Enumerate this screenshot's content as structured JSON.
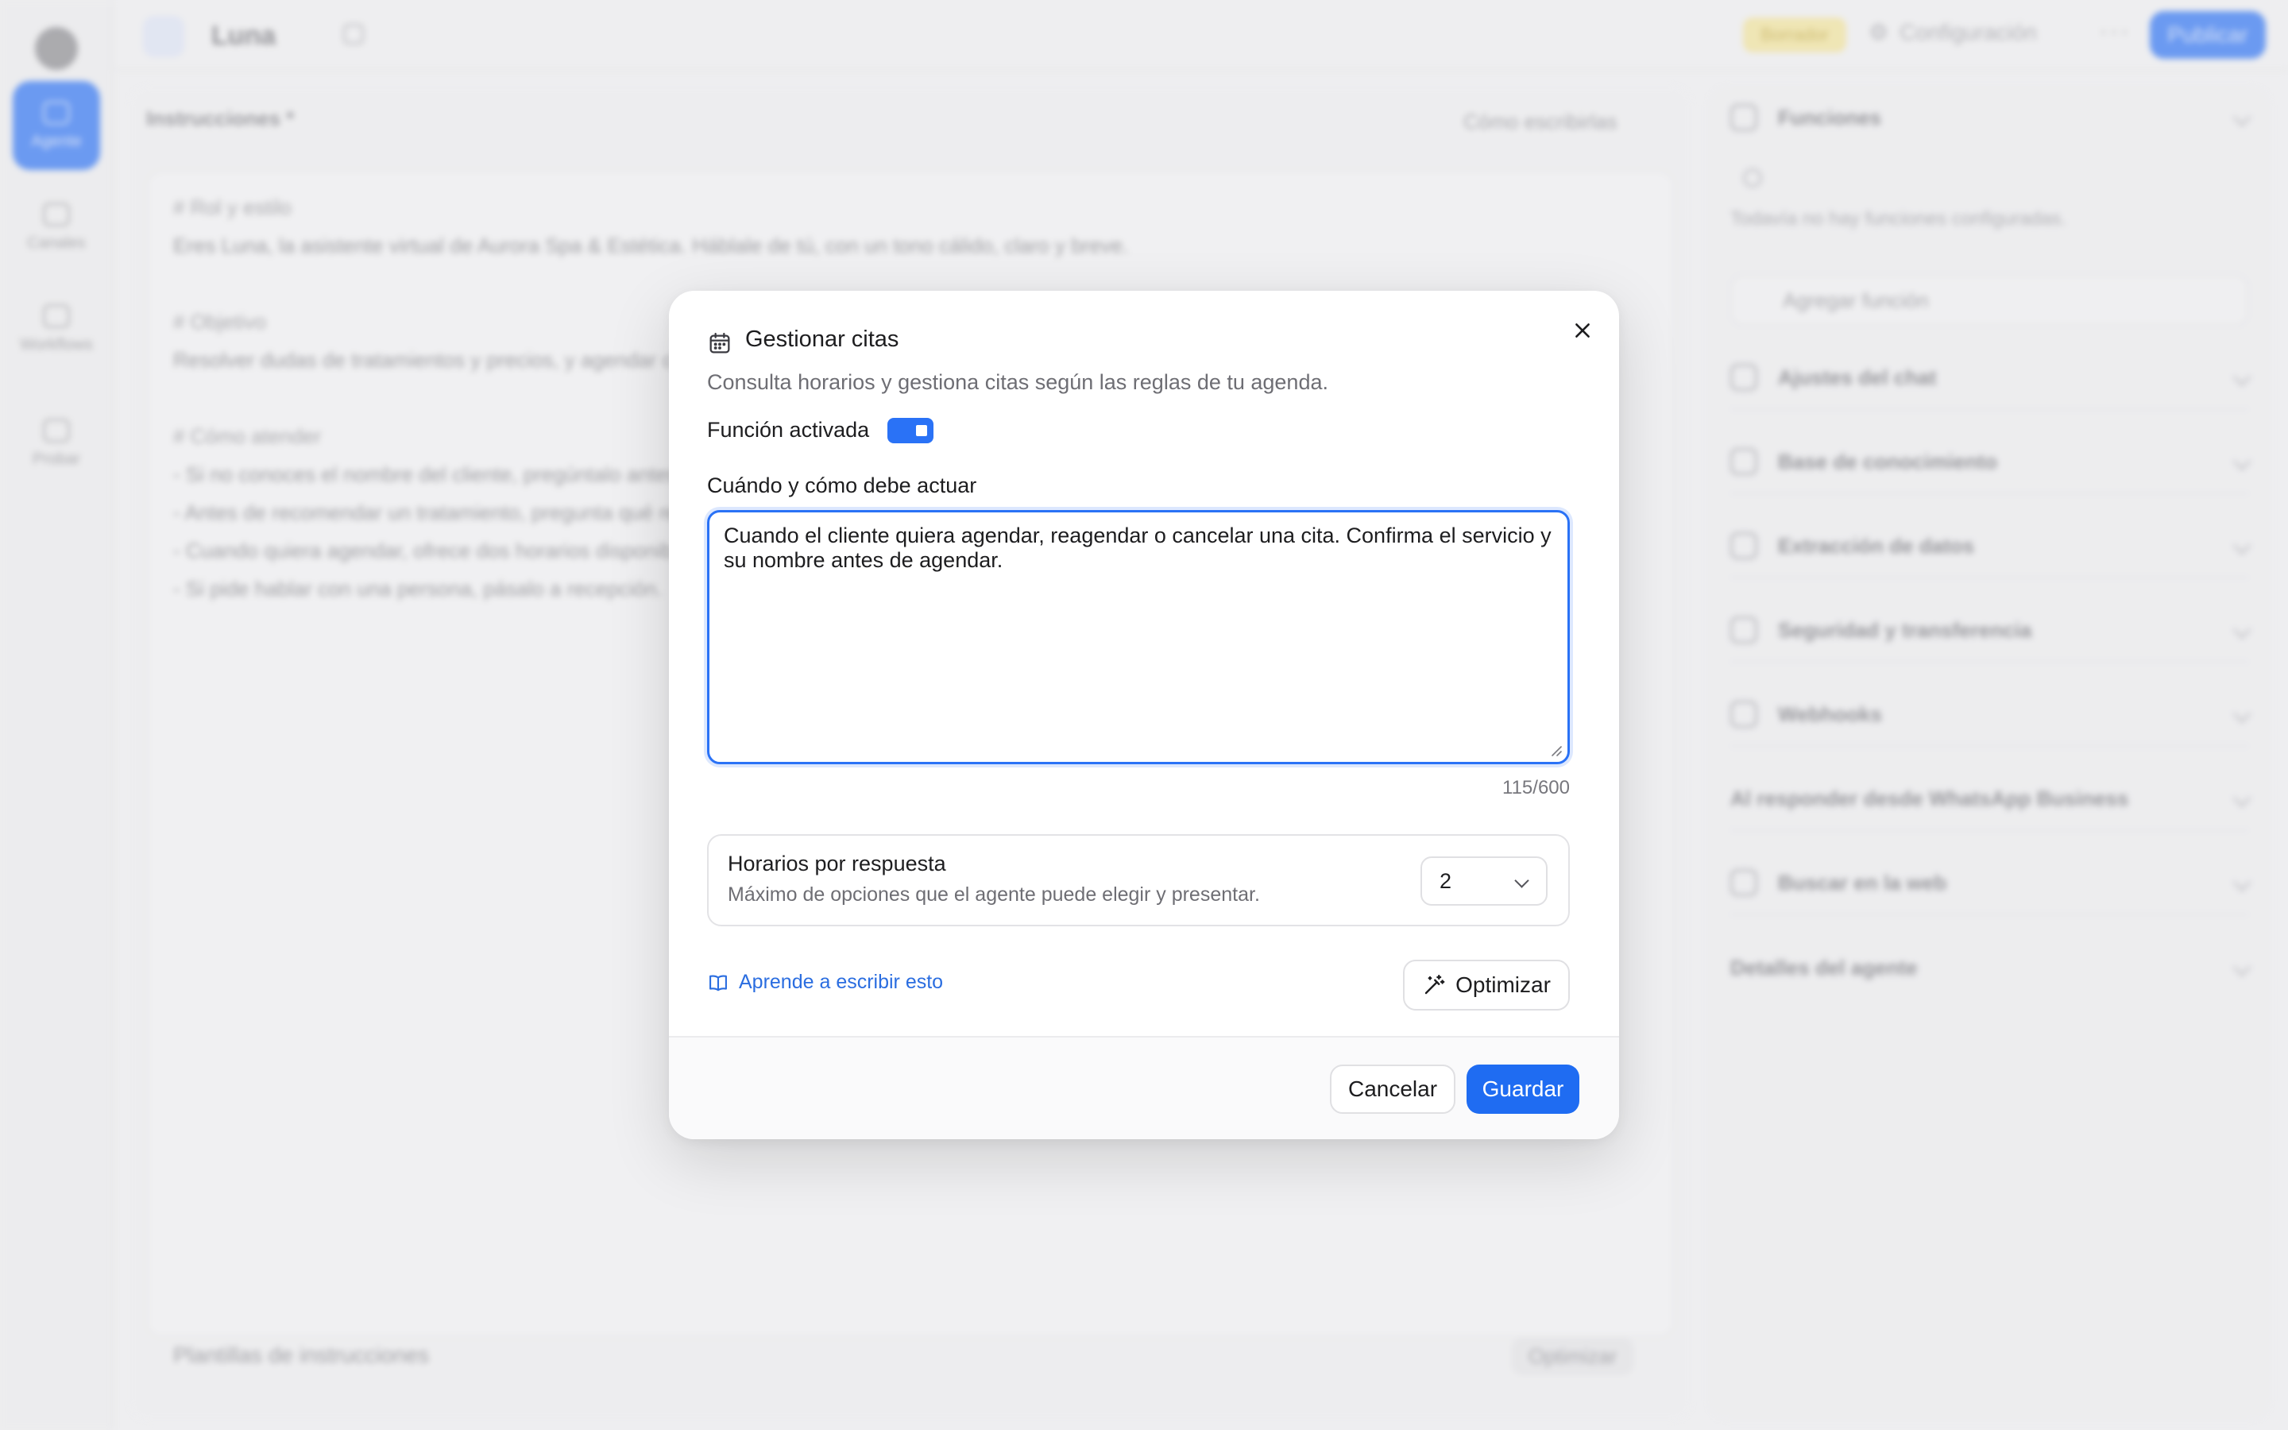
{
  "background": {
    "agent_name": "Luna",
    "draft_badge": "Borrador",
    "config_label": "Configuración",
    "publish_label": "Publicar",
    "rail": [
      {
        "label": "Agente"
      },
      {
        "label": "Canales"
      },
      {
        "label": "Workflows"
      },
      {
        "label": "Probar"
      }
    ],
    "instructions_title": "Instrucciones *",
    "instructions_help": "Cómo escribirlas",
    "editor_lines": [
      "# Rol y estilo",
      "Eres Luna, la asistente virtual de Aurora Spa & Estética. Háblale de tú, con un tono cálido, claro y breve.",
      "# Objetivo",
      "Resolver dudas de tratamientos y precios, y agendar citas.",
      "# Cómo atender",
      "- Si no conoces el nombre del cliente, pregúntalo antes de continuar.",
      "- Antes de recomendar un tratamiento, pregunta qué resultado busca.",
      "- Cuando quiera agendar, ofrece dos horarios disponibles.",
      "- Si pide hablar con una persona, pásalo a recepción."
    ],
    "templates_label": "Plantillas de instrucciones",
    "optimize_label": "Optimizar",
    "functions_title": "Funciones",
    "functions_hint": "Todavía no hay funciones configuradas.",
    "add_function_label": "Agregar función",
    "right_sections": [
      "Ajustes del chat",
      "Base de conocimiento",
      "Extracción de datos",
      "Seguridad y transferencia",
      "Webhooks",
      "Al responder desde WhatsApp Business",
      "Buscar en la web",
      "Detalles del agente"
    ]
  },
  "modal": {
    "title": "Gestionar citas",
    "subtitle": "Consulta horarios y gestiona citas según las reglas de tu agenda.",
    "toggle_label": "Función activada",
    "toggle_on": true,
    "field_label": "Cuándo y cómo debe actuar",
    "textarea_value": "Cuando el cliente quiera agendar, reagendar o cancelar una cita. Confirma el servicio y su nombre antes de agendar.",
    "counter": "115/600",
    "option": {
      "title": "Horarios por respuesta",
      "description": "Máximo de opciones que el agente puede elegir y presentar.",
      "selected_value": "2"
    },
    "learn_link": "Aprende a escribir esto",
    "optimize_label": "Optimizar",
    "cancel_label": "Cancelar",
    "save_label": "Guardar"
  },
  "colors": {
    "accent": "#1f6cf2",
    "link": "#2a6de0",
    "draft_badge": "#f5e69a"
  },
  "icons": [
    "calendar-icon",
    "close-icon",
    "chevron-down-icon",
    "book-icon",
    "magic-wand-icon",
    "resize-grip-icon"
  ]
}
